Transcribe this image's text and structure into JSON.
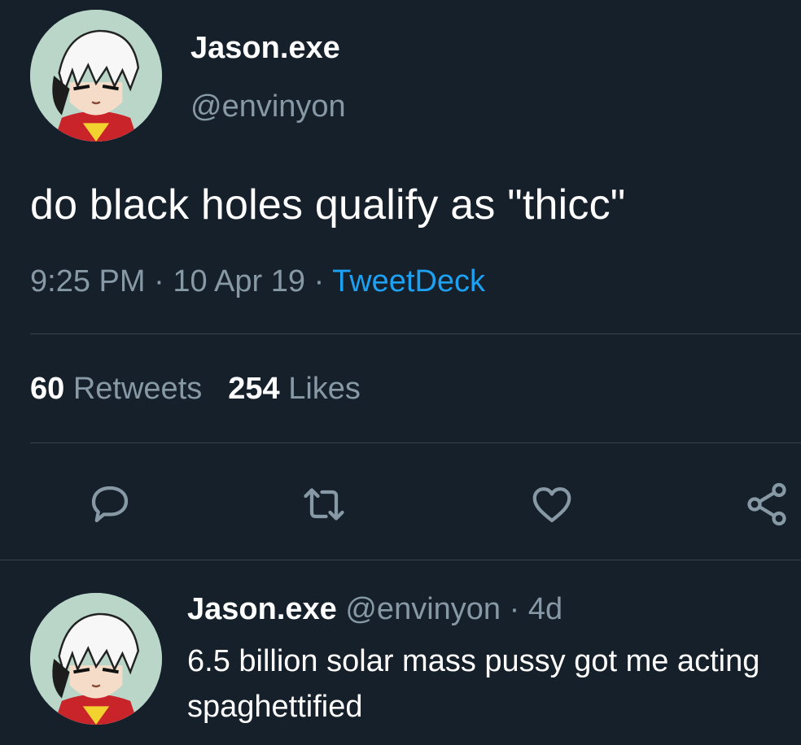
{
  "tweet": {
    "display_name": "Jason.exe",
    "handle": "@envinyon",
    "text": "do black holes qualify as \"thicc\"",
    "time": "9:25 PM",
    "separator": "·",
    "date": "10 Apr 19",
    "source": "TweetDeck",
    "retweets_count": "60",
    "retweets_label": "Retweets",
    "likes_count": "254",
    "likes_label": "Likes"
  },
  "actions": {
    "icons": [
      "reply-icon",
      "retweet-icon",
      "like-icon",
      "share-icon"
    ]
  },
  "reply": {
    "display_name": "Jason.exe",
    "handle": "@envinyon",
    "separator": "·",
    "age": "4d",
    "text": "6.5 billion solar mass pussy got me acting spaghettified"
  },
  "colors": {
    "background": "#15202b",
    "secondary_text": "#8899a6",
    "accent": "#1da1f2",
    "divider": "#38444d"
  }
}
